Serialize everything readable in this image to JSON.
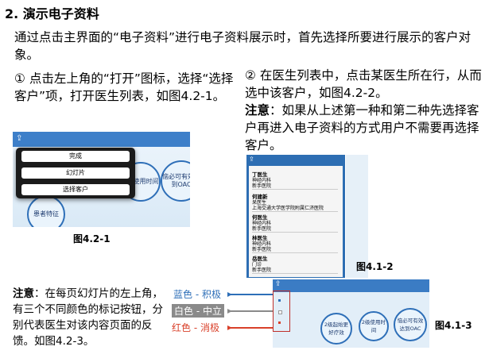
{
  "section_title": "2. 演示电子资料",
  "intro": "通过点击主界面的“电子资料”进行电子资料展示时，首先选择所要进行展示的客户对象。",
  "step1": "① 点击左上角的“打开”图标，选择“选择客户”项，打开医生列表，如图4.2-1。",
  "step2": "② 在医生列表中，点击某医生所在行，从而选中该客户，如图4.2-2。",
  "note_label": "注意",
  "note_text": "：如果从上述第一种和第二种先选择客户再进入电子资料的方式用户不需要再选择客户。",
  "fig1": {
    "menu": [
      "完成",
      "幻灯片",
      "选择客户"
    ],
    "bubbles": [
      "2级使用时间",
      "恼必可有效达到OAC",
      "患者特征"
    ],
    "caption": "图4.2-1"
  },
  "fig2": {
    "doctors": [
      {
        "name": "丁医生",
        "lines": [
          "神经内科",
          "新手医院"
        ]
      },
      {
        "name": "何建新",
        "lines": [
          "呆医生",
          "上海交通大学医学院附属仁济医院"
        ]
      },
      {
        "name": "何医生",
        "lines": [
          "神经内科",
          "新手医院"
        ]
      },
      {
        "name": "林医生",
        "lines": [
          "神经内科",
          "新手医院"
        ]
      },
      {
        "name": "岳医生",
        "lines": [
          "门诊",
          "新手医院"
        ]
      }
    ],
    "caption": "图4.1-2"
  },
  "note2_label": "注意",
  "note2_text": "：在每页幻灯片的左上角，有三个不同颜色的标记按钮，分别代表医生对该内容页面的反馈。如图4.2-3。",
  "legend": {
    "blue": "蓝色 - 积极",
    "white": "白色 - 中立",
    "red": "红色 - 消极",
    "colors": {
      "blue": "#2e6fb8",
      "white": "#8a8a8a",
      "red": "#d9402a"
    }
  },
  "fig3": {
    "bubbles": [
      "2级起始更好疗效",
      "2级使用时间",
      "恼必可有效达到OAC"
    ],
    "caption": "图4.1-3"
  }
}
